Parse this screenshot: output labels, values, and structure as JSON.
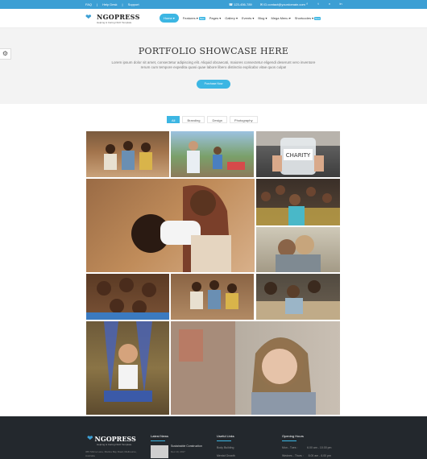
{
  "topbar": {
    "links": [
      "FAQ",
      "Help Desk",
      "Support"
    ],
    "phone": "123-456-789",
    "email": "ID.contact@yourdomain.com",
    "social": [
      "facebook-icon",
      "twitter-icon",
      "vimeo-icon",
      "linkedin-icon"
    ]
  },
  "header": {
    "logo_name": "NGOPRESS",
    "logo_tag": "Helping & Caring NGO Template",
    "nav": [
      {
        "label": "Home",
        "active": true
      },
      {
        "label": "Features",
        "badge": "New"
      },
      {
        "label": "Pages"
      },
      {
        "label": "Gallery"
      },
      {
        "label": "Events"
      },
      {
        "label": "Blog"
      },
      {
        "label": "Mega Menu"
      },
      {
        "label": "Shortcodes",
        "badge": "New"
      }
    ]
  },
  "hero": {
    "title": "PORTFOLIO SHOWCASE HERE",
    "text": "Lorem ipsum dolor sit amet, consectetur adipiscing elit. Aliquid obcaecati, maiores consectetur eligendi deserunt vero inventore rerum cum tempore expedita quasi quae labore libero distinctio explicabo vitae quos culpa!",
    "button": "Purchase Now"
  },
  "filters": [
    {
      "label": "All",
      "active": true
    },
    {
      "label": "Branding"
    },
    {
      "label": "Design"
    },
    {
      "label": "Photography"
    }
  ],
  "photos": [
    {
      "name": "photo-children-group"
    },
    {
      "name": "photo-volunteers-outdoor"
    },
    {
      "name": "photo-charity-jar"
    },
    {
      "name": "photo-child-carried"
    },
    {
      "name": "photo-classroom-kids"
    },
    {
      "name": "photo-hug"
    },
    {
      "name": "photo-smiling-kids"
    },
    {
      "name": "photo-children-sitting"
    },
    {
      "name": "photo-boys-portrait"
    },
    {
      "name": "photo-girl-swing"
    },
    {
      "name": "photo-sad-girl"
    }
  ],
  "footer": {
    "logo_name": "NGOPRESS",
    "logo_tag": "Helping & Caring NGO Template",
    "address": "365 Shrine Lane, Marina Bay Road, Melbourne, Australia",
    "latest_news_title": "Latest News",
    "latest_news_item": "Sustainable Construction",
    "latest_news_date": "Dec 10, 2017",
    "links_title": "Useful Links",
    "links": [
      "Body Building",
      "Mental Growth"
    ],
    "hours_title": "Opening Hours",
    "hours": [
      "Mon - Tues :",
      "Wednes - Thurs :"
    ],
    "times": [
      "6.00 am - 10.00 pm",
      "8.00 am - 6.00 pm"
    ]
  },
  "colors": {
    "accent": "#3cb6e3",
    "topbar": "#3c9fd4",
    "footer": "#23282d"
  }
}
